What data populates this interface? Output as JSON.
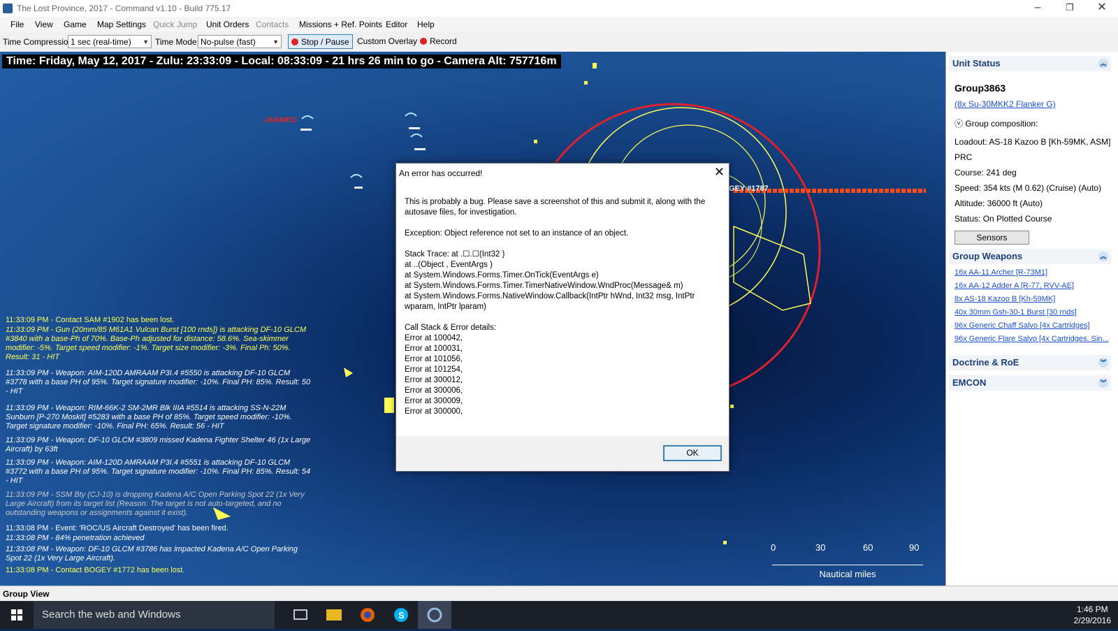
{
  "window": {
    "title": "The Lost Province, 2017 - Command v1.10 - Build 775.17",
    "minimize": "–",
    "maximize": "❐",
    "close": "✕"
  },
  "menu": [
    "File",
    "View",
    "Game",
    "Map Settings",
    "Quick Jump",
    "Unit Orders",
    "Contacts",
    "Missions + Ref. Points",
    "Editor",
    "Help"
  ],
  "toolbar": {
    "time_compression_label": "Time Compression:",
    "time_compression_value": "1 sec (real-time)",
    "time_mode_label": "Time Mode:",
    "time_mode_value": "No-pulse (fast)",
    "stop_pause": "Stop / Pause",
    "custom_overlay": "Custom Overlay",
    "record": "Record"
  },
  "map": {
    "timebar": "Time: Friday, May 12, 2017 - Zulu: 23:33:09 - Local: 08:33:09 - 21 hrs 26 min to go -  Camera Alt: 757716m",
    "jammed_label": "JAMMED",
    "bogey_label": "GEY #1787",
    "log": [
      {
        "text": "11:33:09 PM - Contact SAM #1902 has been lost.",
        "style": "yellow"
      },
      {
        "text": "11:33:09 PM - Gun (20mm/85 M61A1 Vulcan Burst [100 rnds]) is attacking DF-10 GLCM #3840 with a base-Ph of 70%. Base-Ph adjusted for distance: 58.6%. Sea-skimmer modifier: -5%.  Target speed modifier: -1%.  Target size modifier: -3%. Final Ph: 50%. Result: 31 - HIT",
        "style": "yellow italic"
      },
      {
        "text": "11:33:09 PM - Weapon: AIM-120D AMRAAM P3I.4 #5550 is attacking DF-10 GLCM #3778 with a base PH of 95%.  Target signature modifier: -10%. Final PH: 85%. Result: 50 - HIT",
        "style": "italic"
      },
      {
        "text": "11:33:09 PM - Weapon: RIM-66K-2 SM-2MR Blk IIIA #5514 is attacking SS-N-22M Sunburn [P-270 Moskit] #5283 with a base PH of 85%.  Target speed modifier: -10%.  Target signature modifier: -10%. Final PH: 65%. Result: 56 - HIT",
        "style": "italic"
      },
      {
        "text": "11:33:09 PM - Weapon: DF-10 GLCM #3809 missed Kadena Fighter Shelter 46 (1x Large Aircraft) by 63ft",
        "style": "italic"
      },
      {
        "text": "11:33:09 PM - Weapon: AIM-120D AMRAAM P3I.4 #5551 is attacking DF-10 GLCM #3772 with a base PH of 95%.  Target signature modifier: -10%. Final PH: 85%. Result: 54 - HIT",
        "style": "italic"
      },
      {
        "text": "11:33:09 PM - SSM Bty (CJ-10) is dropping Kadena A/C Open Parking Spot 22 (1x Very Large Aircraft) from its target list (Reason: The target is not auto-targeted, and no outstanding weapons or assignments against it exist).",
        "style": "dim"
      },
      {
        "text": "11:33:08 PM - Event: 'ROC/US Aircraft Destroyed' has been fired.",
        "style": "white"
      },
      {
        "text": "11:33:08 PM - 84% penetration achieved",
        "style": "italic"
      },
      {
        "text": "11:33:08 PM - Weapon: DF-10 GLCM #3786 has impacted Kadena A/C Open Parking Spot 22 (1x Very Large Aircraft).",
        "style": "italic"
      },
      {
        "text": "11:33:08 PM - Contact BOGEY #1772 has been lost.",
        "style": "yellow"
      }
    ],
    "scale": {
      "ticks": [
        "0",
        "30",
        "60",
        "90"
      ],
      "caption": "Nautical miles"
    }
  },
  "dialog": {
    "title": "An error has occurred!",
    "close": "✕",
    "message": "This is probably a bug. Please save a screenshot of this and submit it, along with the autosave files, for investigation.",
    "exception": "Exception: Object reference not set to an instance of an object.",
    "stack_trace": [
      "Stack Trace:    at .☐.☐(Int32 )",
      "   at ..(Object , EventArgs )",
      "   at System.Windows.Forms.Timer.OnTick(EventArgs e)",
      "   at System.Windows.Forms.Timer.TimerNativeWindow.WndProc(Message& m)",
      "   at System.Windows.Forms.NativeWindow.Callback(IntPtr hWnd, Int32 msg, IntPtr wparam, IntPtr lparam)"
    ],
    "call_stack_header": "Call Stack & Error details:",
    "errors": [
      "Error at 100042,",
      "Error at 100031,",
      "Error at 101056,",
      "Error at 101254,",
      "Error at 300012,",
      "Error at 300006,",
      "Error at 300009,",
      "Error at 300000,"
    ],
    "ok": "OK"
  },
  "panel": {
    "unit_status": "Unit Status",
    "group_name": "Group3863",
    "group_type": "(8x Su-30MKK2 Flanker G)",
    "group_composition": "Group composition:",
    "loadout": "Loadout: AS-18 Kazoo B [Kh-59MK, ASM]",
    "side": "PRC",
    "course": "Course: 241 deg",
    "speed": "Speed: 354 kts (M 0.62) (Cruise)   (Auto)",
    "altitude": "Altitude: 36000 ft   (Auto)",
    "status": "Status: On Plotted Course",
    "sensors": "Sensors",
    "group_weapons": "Group Weapons",
    "weapons": [
      "16x AA-11 Archer [R-73M1]",
      "16x AA-12 Adder A [R-77, RVV-AE]",
      "8x AS-18 Kazoo B [Kh-59MK]",
      "40x 30mm Gsh-30-1 Burst [30 rnds]",
      "96x Generic Chaff Salvo [4x Cartridges]",
      "96x Generic Flare Salvo [4x Cartridges, Sin..."
    ],
    "doctrine": "Doctrine & RoE",
    "emcon": "EMCON"
  },
  "statusbar": {
    "text": "Group View"
  },
  "taskbar": {
    "search_placeholder": "Search the web and Windows",
    "time": "1:46 PM",
    "date": "2/29/2016"
  }
}
